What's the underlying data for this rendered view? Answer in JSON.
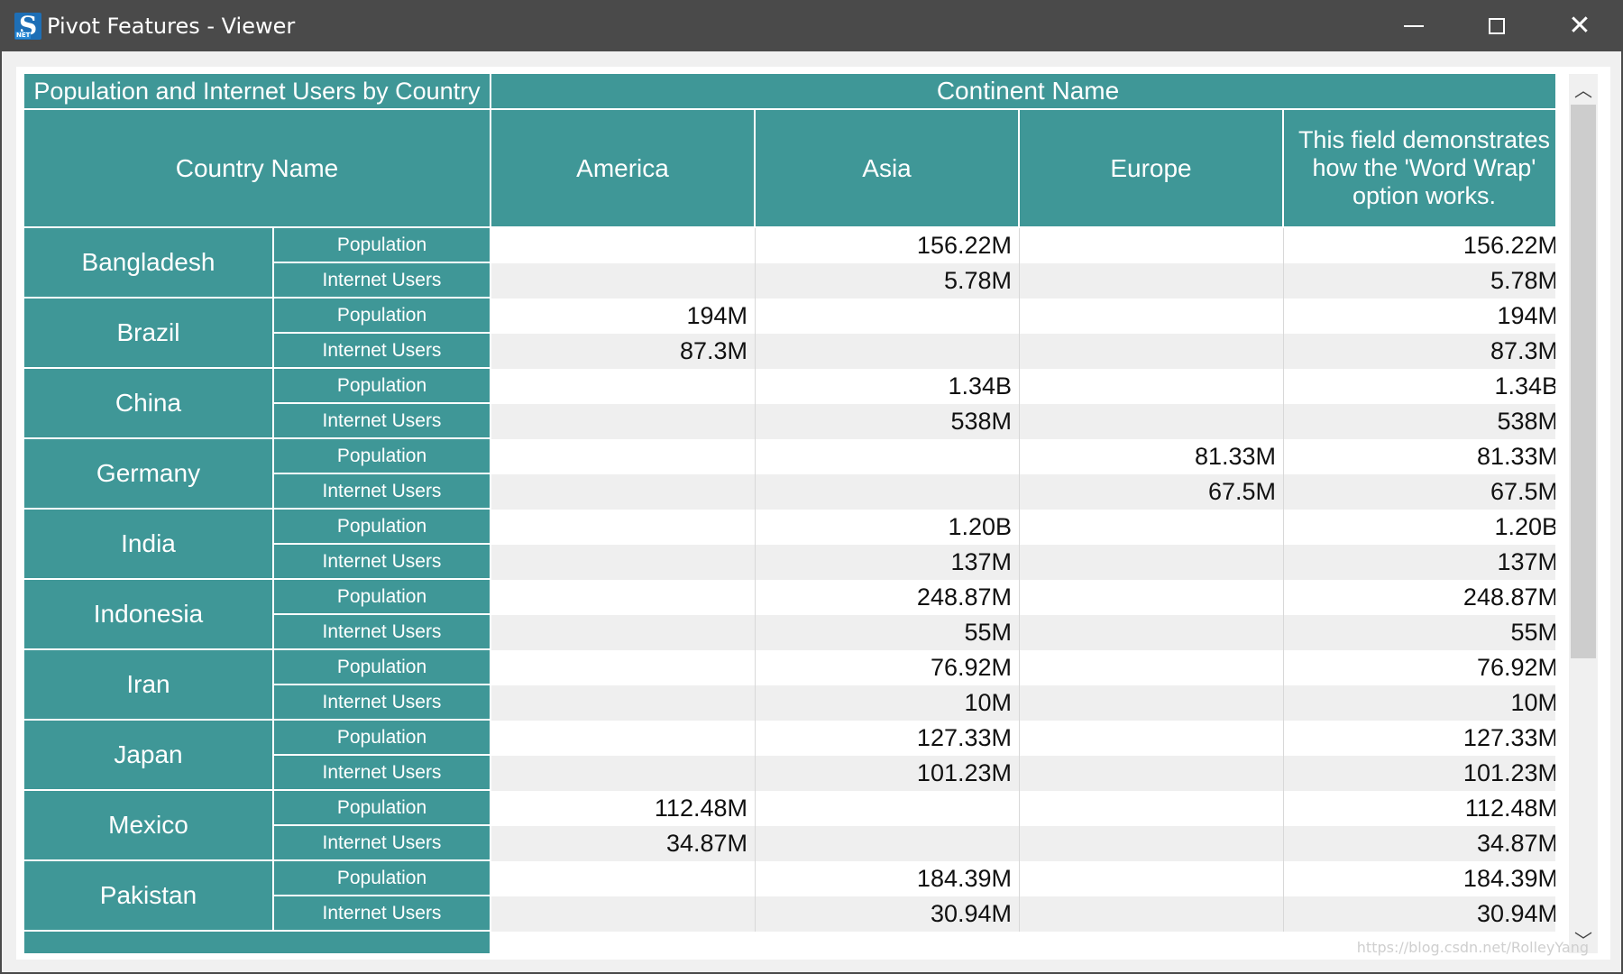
{
  "window": {
    "title": "Pivot Features - Viewer",
    "controls": {
      "minimize": "—",
      "maximize": "□",
      "close": "✕"
    }
  },
  "pivot": {
    "corner_title": "Population and Internet Users by Country",
    "column_field": "Continent Name",
    "row_field": "Country Name",
    "columns": [
      "America",
      "Asia",
      "Europe",
      "This field demonstrates how the 'Word Wrap' option works."
    ],
    "measures": [
      "Population",
      "Internet Users"
    ],
    "rows": [
      {
        "country": "Bangladesh",
        "population": [
          "",
          "156.22M",
          "",
          "156.22M"
        ],
        "internet": [
          "",
          "5.78M",
          "",
          "5.78M"
        ]
      },
      {
        "country": "Brazil",
        "population": [
          "194M",
          "",
          "",
          "194M"
        ],
        "internet": [
          "87.3M",
          "",
          "",
          "87.3M"
        ]
      },
      {
        "country": "China",
        "population": [
          "",
          "1.34B",
          "",
          "1.34B"
        ],
        "internet": [
          "",
          "538M",
          "",
          "538M"
        ]
      },
      {
        "country": "Germany",
        "population": [
          "",
          "",
          "81.33M",
          "81.33M"
        ],
        "internet": [
          "",
          "",
          "67.5M",
          "67.5M"
        ]
      },
      {
        "country": "India",
        "population": [
          "",
          "1.20B",
          "",
          "1.20B"
        ],
        "internet": [
          "",
          "137M",
          "",
          "137M"
        ]
      },
      {
        "country": "Indonesia",
        "population": [
          "",
          "248.87M",
          "",
          "248.87M"
        ],
        "internet": [
          "",
          "55M",
          "",
          "55M"
        ]
      },
      {
        "country": "Iran",
        "population": [
          "",
          "76.92M",
          "",
          "76.92M"
        ],
        "internet": [
          "",
          "10M",
          "",
          "10M"
        ]
      },
      {
        "country": "Japan",
        "population": [
          "",
          "127.33M",
          "",
          "127.33M"
        ],
        "internet": [
          "",
          "101.23M",
          "",
          "101.23M"
        ]
      },
      {
        "country": "Mexico",
        "population": [
          "112.48M",
          "",
          "",
          "112.48M"
        ],
        "internet": [
          "34.87M",
          "",
          "",
          "34.87M"
        ]
      },
      {
        "country": "Pakistan",
        "population": [
          "",
          "184.39M",
          "",
          "184.39M"
        ],
        "internet": [
          "",
          "30.94M",
          "",
          "30.94M"
        ]
      }
    ]
  },
  "scrollbar": {
    "up_arrow": "︿",
    "down_arrow": "﹀"
  },
  "watermark": "https://blog.csdn.net/RolleyYang",
  "colors": {
    "header": "#3f9797",
    "alt_row": "#efefef",
    "titlebar": "#4a4a4a"
  }
}
